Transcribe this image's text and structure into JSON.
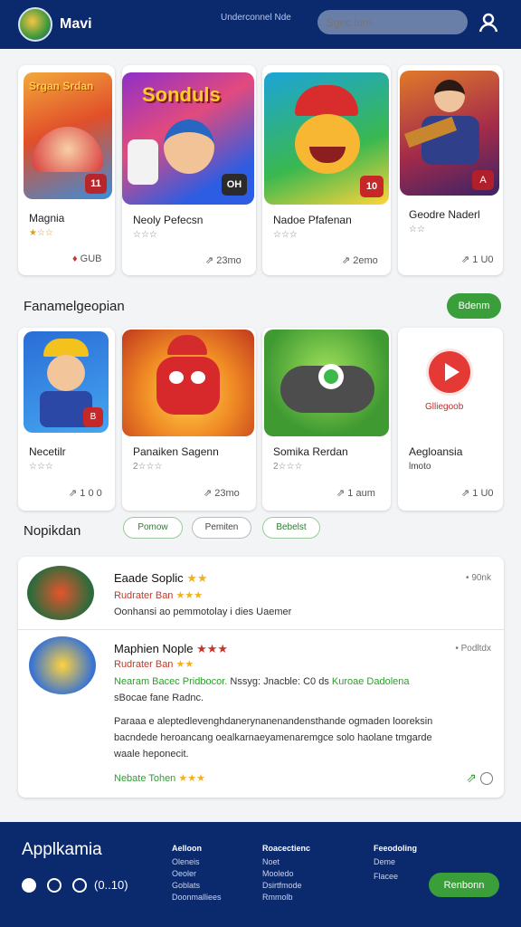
{
  "header": {
    "brand": "Mavi",
    "tagline": "Underconnel Nde",
    "search_placeholder": "Sgoc lum"
  },
  "top_apps": [
    {
      "art": "Srgan Srdan",
      "title": "Magnia",
      "rating": "★☆☆",
      "meta": "GUB",
      "badge": "11"
    },
    {
      "art": "Sonduls",
      "title": "Neoly Pefecsn",
      "rating": "☆☆☆",
      "meta": "23mo",
      "badge": "OH"
    },
    {
      "art": "",
      "title": "Nadoe Pfafenan",
      "rating": "☆☆☆",
      "meta": "2emo",
      "badge": "10"
    },
    {
      "art": "",
      "title": "Geodre Naderl",
      "rating": "☆☆",
      "meta": "1 U0",
      "badge": "A"
    }
  ],
  "section1": {
    "title": "Fanamelgeopian",
    "button": "Bdenm"
  },
  "featured_apps": [
    {
      "title": "Necetilr",
      "rating": "☆☆☆",
      "meta": "1 0 0",
      "badge": "B"
    },
    {
      "title": "Panaiken Sagenn",
      "rating": "2☆☆☆",
      "meta": "23mo",
      "badge": ""
    },
    {
      "title": "Somika Rerdan",
      "rating": "2☆☆☆",
      "meta": "1 aum",
      "badge": ""
    },
    {
      "title": "Aegloansia",
      "rating": "lmoto",
      "meta": "1 U0",
      "badge": "",
      "art_label": "Glliegoob"
    }
  ],
  "section2": {
    "title": "Nopikdan",
    "chips": [
      "Pomow",
      "Pemiten",
      "Bebelst"
    ]
  },
  "reviews": [
    {
      "title": "Eaade Soplic",
      "sub": "Rudrater Ban",
      "text": "Oonhansi ao pemmotolay i dies Uaemer",
      "meta": "90nk"
    },
    {
      "title": "Maphien Nople",
      "stars2": "★★★",
      "sub": "Rudrater Ban",
      "line1": "Nearam Bacec Pridbocor.",
      "line1b": "Nssyg: Jnacble: C0 ds",
      "line1c": "Kuroae Dadolena",
      "line2": "sBocae fane Radnc.",
      "para": [
        "Paraaa e aleptedlevenghdanerynanenandensthande ogmaden looreksin",
        "bacndede heroancang oealkarnaeyamenaremgce solo haolane tmgarde",
        "waale heponecit."
      ],
      "foot": "Nebate Tohen",
      "meta": "Podltdx"
    }
  ],
  "footer": {
    "brand": "Applkamia",
    "social": "(0..10)",
    "cols": [
      {
        "head": "Aelloon",
        "links": [
          "Oleneis",
          "Oeoler",
          "Goblats",
          "Doonmalliees"
        ]
      },
      {
        "head": "Roacectienc",
        "links": [
          "Noet",
          "Mooledo",
          "Dsirtfmode",
          "Rmmolb"
        ]
      },
      {
        "head": "Feeodoling",
        "links": [
          "Deme",
          "Flacee"
        ]
      }
    ],
    "button": "Renbonn"
  }
}
